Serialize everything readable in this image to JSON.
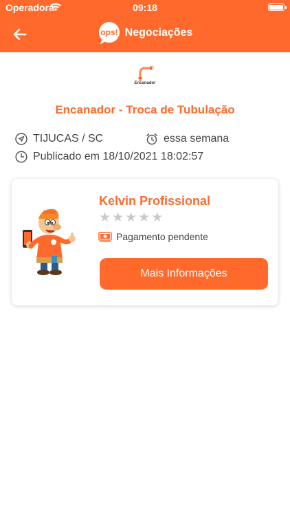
{
  "status_bar": {
    "carrier": "Operadora",
    "time": "09:18"
  },
  "nav": {
    "title": "Negociações",
    "logo_text": "ops!"
  },
  "category": {
    "label": "Encanador"
  },
  "job": {
    "title": "Encanador - Troca de Tubulação",
    "location": "TIJUCAS / SC",
    "schedule": "essa semana",
    "published": "Publicado em 18/10/2021 18:02:57"
  },
  "professional": {
    "name": "Kelvin Profissional",
    "rating": 0,
    "max_rating": 5,
    "payment_status": "Pagamento pendente",
    "more_info_label": "Mais Informações"
  },
  "colors": {
    "accent": "#ff6a2c",
    "star_empty": "#c9c9c9"
  }
}
